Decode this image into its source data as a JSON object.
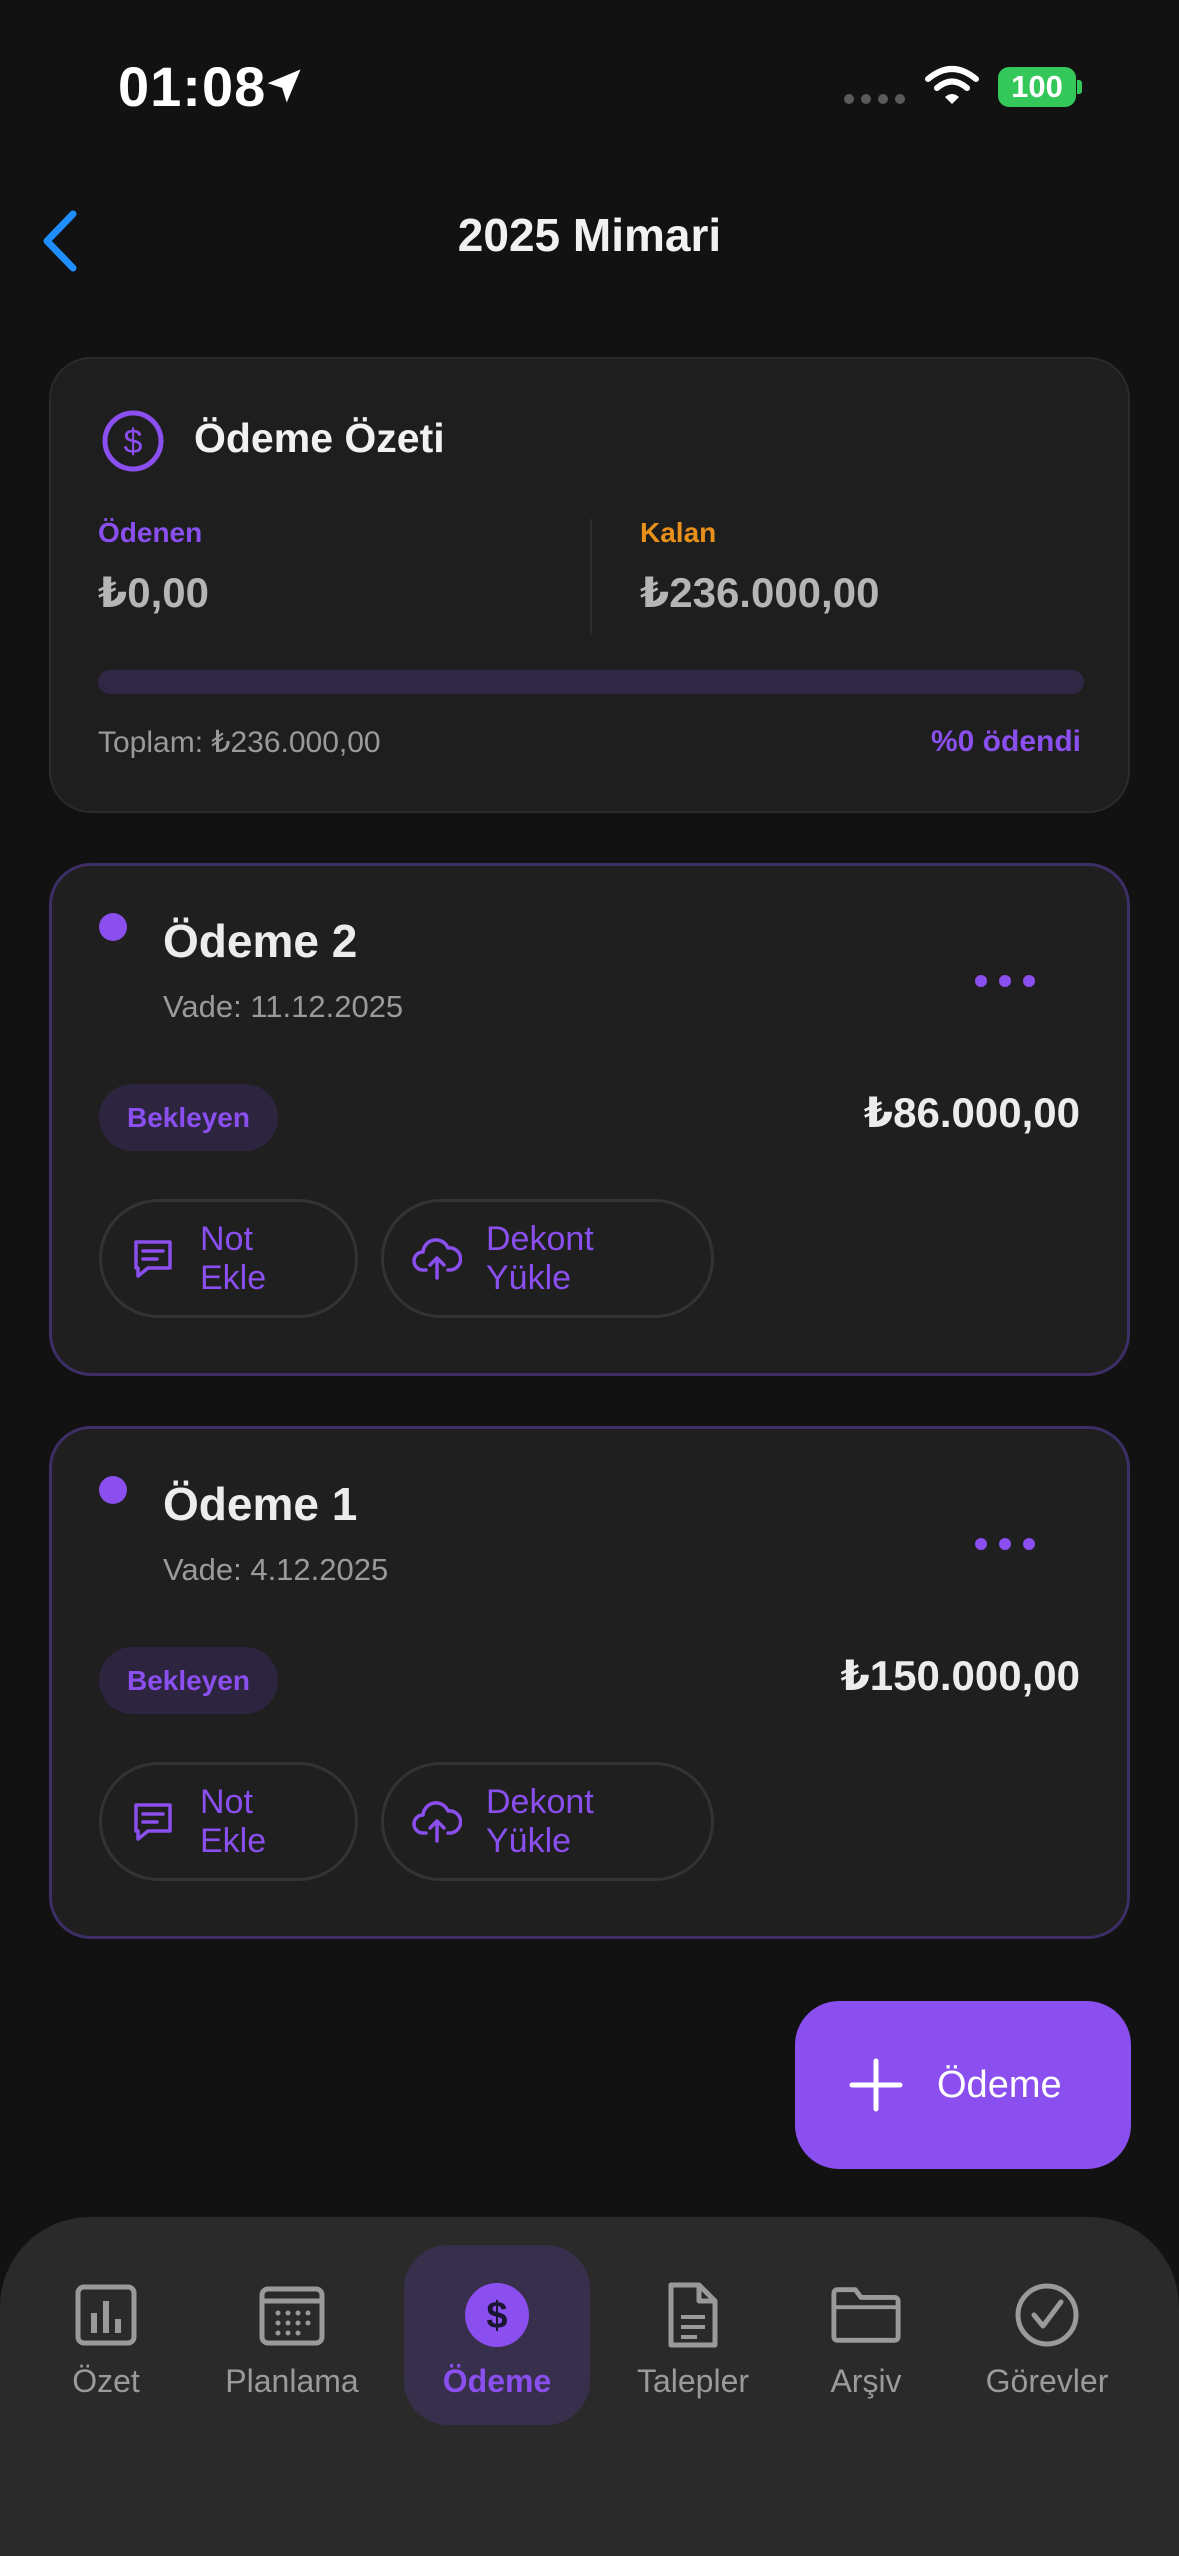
{
  "status_bar": {
    "time": "01:08",
    "battery": "100"
  },
  "header": {
    "title": "2025 Mimari"
  },
  "summary": {
    "title": "Ödeme Özeti",
    "paid_label": "Ödenen",
    "paid_value": "₺0,00",
    "remaining_label": "Kalan",
    "remaining_value": "₺236.000,00",
    "total_text": "Toplam: ₺236.000,00",
    "percent_text": "%0 ödendi",
    "progress_fraction": 0
  },
  "payments": [
    {
      "title": "Ödeme 2",
      "due": "Vade: 11.12.2025",
      "status": "Bekleyen",
      "amount": "₺86.000,00",
      "note_label": "Not Ekle",
      "upload_label": "Dekont Yükle"
    },
    {
      "title": "Ödeme 1",
      "due": "Vade: 4.12.2025",
      "status": "Bekleyen",
      "amount": "₺150.000,00",
      "note_label": "Not Ekle",
      "upload_label": "Dekont Yükle"
    }
  ],
  "fab": {
    "label": "Ödeme",
    "icon": "plus-icon"
  },
  "tabs": [
    {
      "label": "Özet",
      "icon": "chart-icon",
      "active": false
    },
    {
      "label": "Planlama",
      "icon": "calendar-icon",
      "active": false
    },
    {
      "label": "Ödeme",
      "icon": "dollar-icon",
      "active": true
    },
    {
      "label": "Talepler",
      "icon": "document-icon",
      "active": false
    },
    {
      "label": "Arşiv",
      "icon": "folder-icon",
      "active": false
    },
    {
      "label": "Görevler",
      "icon": "checkmark-icon",
      "active": false
    }
  ],
  "colors": {
    "accent": "#8a4fee",
    "warning": "#e8901c",
    "background": "#121212",
    "card": "#1e1e1e",
    "link": "#1f8fff"
  }
}
